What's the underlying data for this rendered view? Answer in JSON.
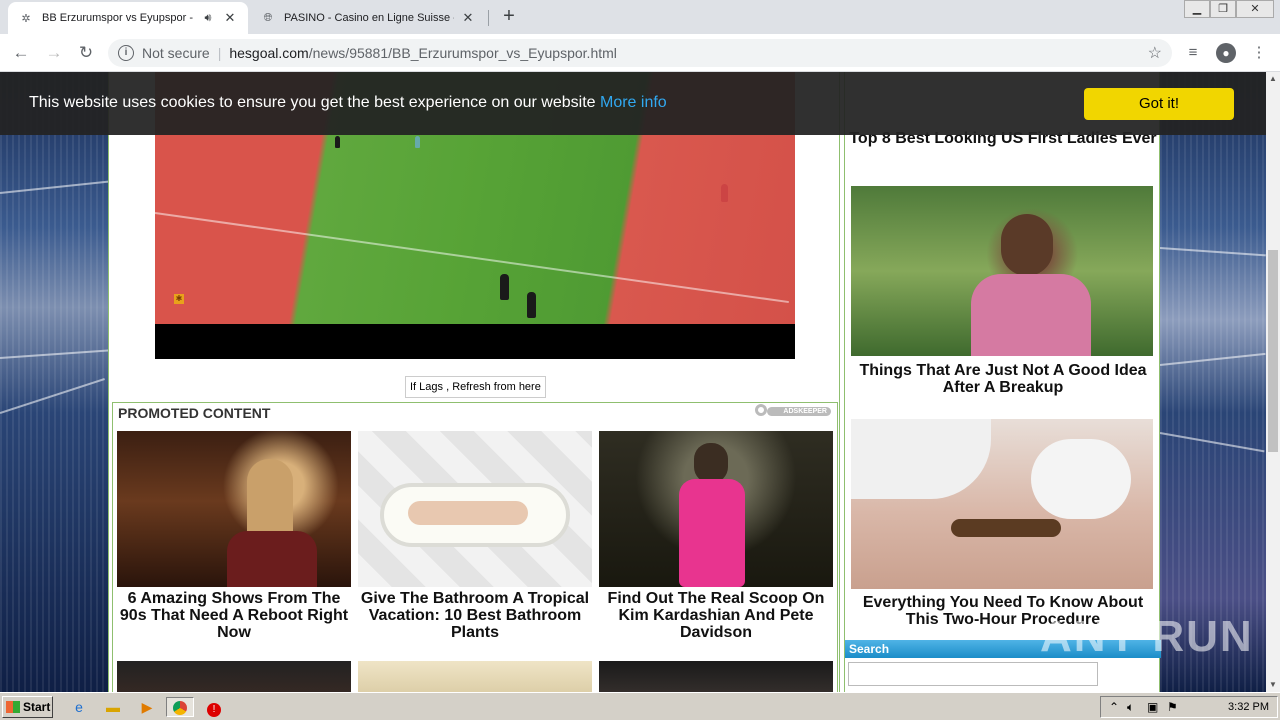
{
  "browser": {
    "tabs": [
      {
        "title": "BB Erzurumspor vs Eyupspor - H",
        "active": true
      },
      {
        "title": "PASINO - Casino en Ligne Suisse - Su",
        "active": false
      }
    ],
    "address": {
      "security_label": "Not secure",
      "host": "hesgoal.com",
      "path": "/news/95881/BB_Erzurumspor_vs_Eyupspor.html"
    }
  },
  "cookie_bar": {
    "message": "This website uses cookies to ensure you get the best experience on our website ",
    "more_link": "More info",
    "accept_label": "Got it!"
  },
  "player": {
    "refresh_label": "If Lags , Refresh from here"
  },
  "promoted": {
    "heading": "PROMOTED CONTENT",
    "provider_label": "ADSKEEPER",
    "cards": [
      {
        "caption": "6 Amazing Shows From The 90s That Need A Reboot Right Now"
      },
      {
        "caption": "Give The Bathroom A Tropical Vacation: 10 Best Bathroom Plants"
      },
      {
        "caption": "Find Out The Real Scoop On Kim Kardashian And Pete Davidson"
      }
    ]
  },
  "sidebar": {
    "items": [
      {
        "title": "Top 8 Best Looking US First Ladies Ever"
      },
      {
        "title": "Things That Are Just Not A Good Idea After A Breakup"
      },
      {
        "title": "Everything You Need To Know About This Two-Hour Procedure"
      }
    ],
    "search_label": "Search"
  },
  "taskbar": {
    "start_label": "Start",
    "clock": "3:32 PM"
  },
  "watermark": "ANY RUN"
}
